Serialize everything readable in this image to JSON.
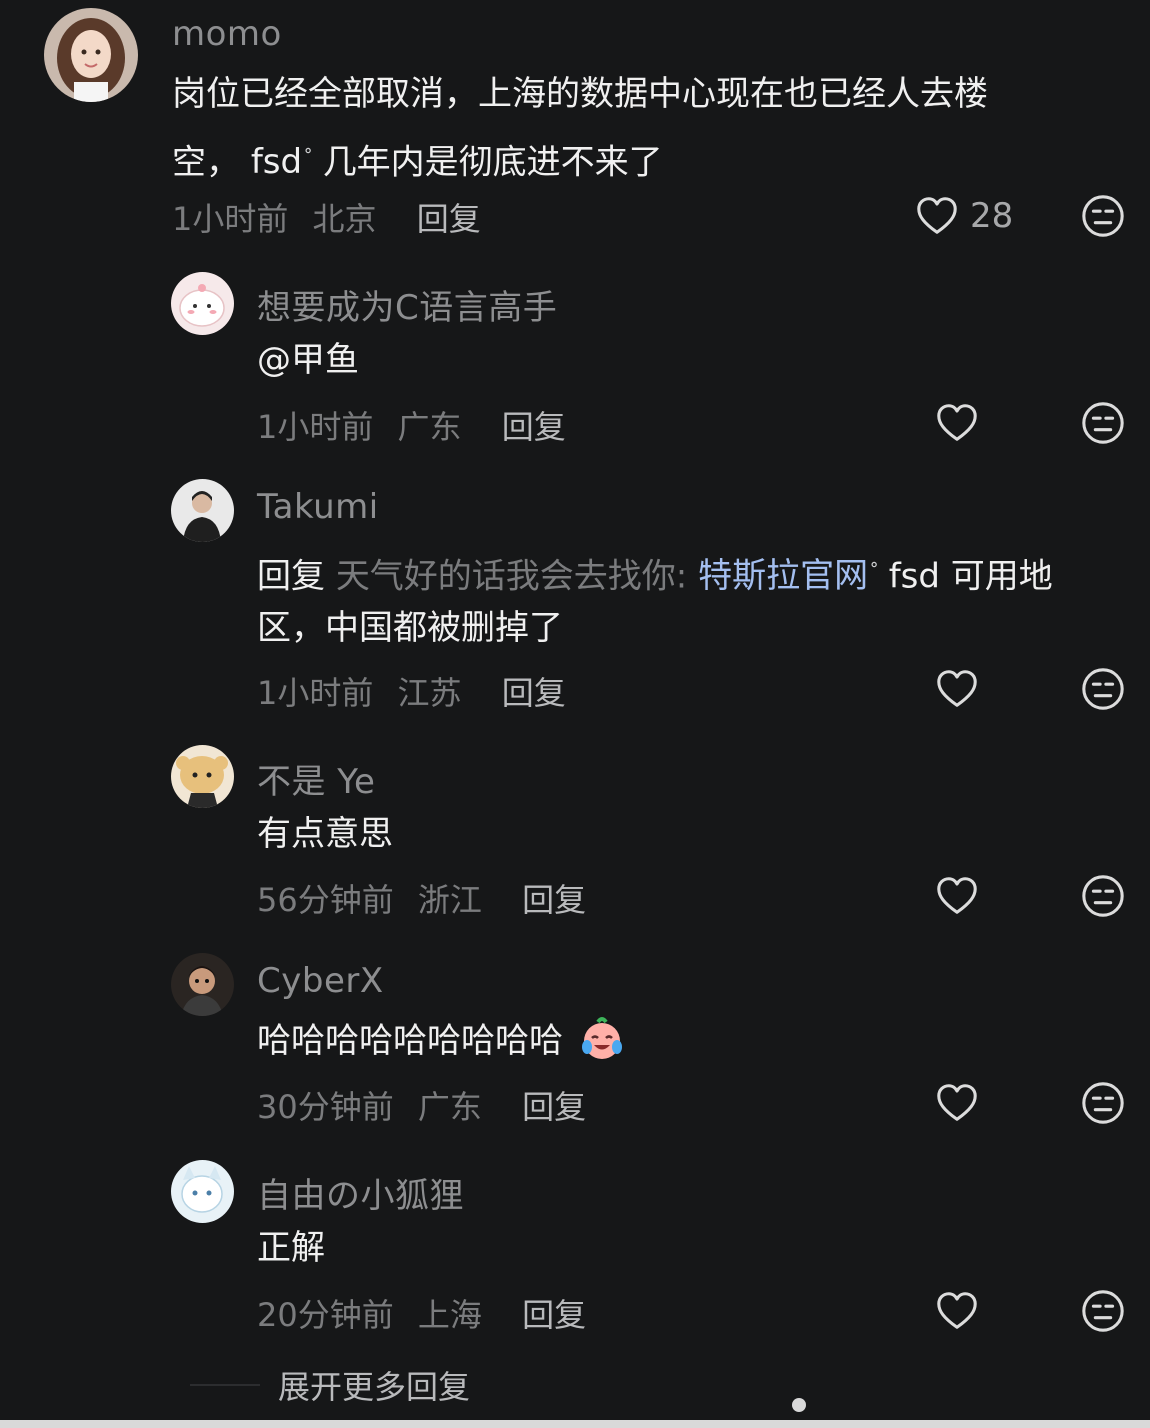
{
  "comments": [
    {
      "username": "momo",
      "text_line1": "岗位已经全部取消，上海的数据中心现在也已经人去楼",
      "text_line2_a": "空，",
      "text_line2_link": "fsd",
      "text_line2_b": " 几年内是彻底进不来了",
      "time": "1小时前",
      "location": "北京",
      "reply_label": "回复",
      "likes": "28"
    },
    {
      "username": "想要成为C语言高手",
      "text": "@甲鱼",
      "time": "1小时前",
      "location": "广东",
      "reply_label": "回复"
    },
    {
      "username": "Takumi",
      "reply_prefix": "回复",
      "reply_target": "天气好的话我会去找你:",
      "link": "特斯拉官网",
      "text_line1_b": " fsd 可用地",
      "text_line2": "区，中国都被删掉了",
      "time": "1小时前",
      "location": "江苏",
      "reply_label": "回复"
    },
    {
      "username": "不是 Ye",
      "text": "有点意思",
      "time": "56分钟前",
      "location": "浙江",
      "reply_label": "回复"
    },
    {
      "username": "CyberX",
      "text": "哈哈哈哈哈哈哈哈哈",
      "time": "30分钟前",
      "location": "广东",
      "reply_label": "回复"
    },
    {
      "username": "自由の小狐狸",
      "text": "正解",
      "time": "20分钟前",
      "location": "上海",
      "reply_label": "回复"
    }
  ],
  "expand_label": "展开更多回复",
  "icons": {
    "like": "heart-outline-icon",
    "dislike": "unamused-face-icon",
    "search": "search-icon",
    "laugh_emoji": "laughing-crying-emoji"
  },
  "colors": {
    "background": "#161718",
    "link": "#a4bff0",
    "secondary_text": "#7b7c7e"
  }
}
